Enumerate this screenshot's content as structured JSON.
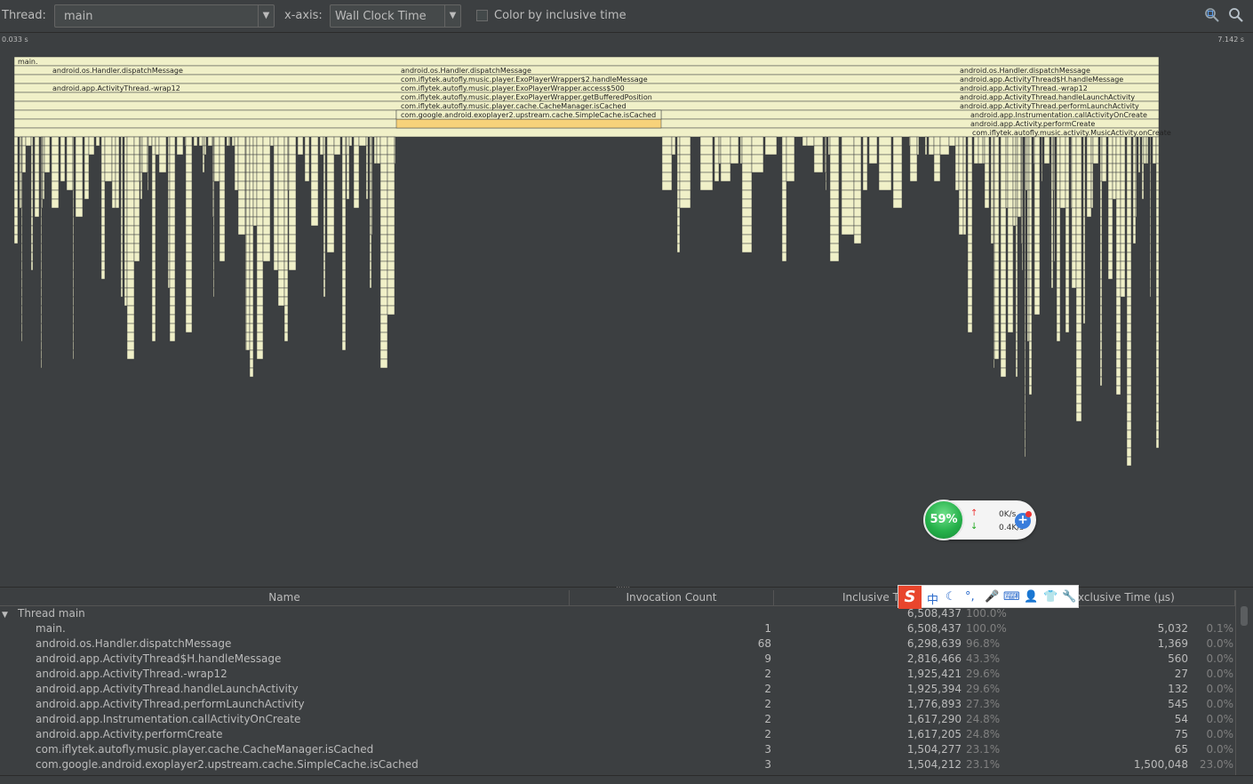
{
  "toolbar": {
    "thread_label": "Thread:",
    "thread_value": "main",
    "xaxis_label": "x-axis:",
    "xaxis_value": "Wall Clock Time",
    "color_checkbox_label": "Color by inclusive time",
    "color_checkbox_checked": false
  },
  "timebar": {
    "start": "0.033 s",
    "end": "7.142 s"
  },
  "flame_labels": [
    "main.",
    "android.os.Handler.dispatchMessage",
    "android.app.ActivityThread.-wrap12",
    "android.os.Handler.dispatchMessage",
    "com.iflytek.autofly.music.player.ExoPlayerWrapper$2.handleMessage",
    "com.iflytek.autofly.music.player.ExoPlayerWrapper.access$500",
    "com.iflytek.autofly.music.player.ExoPlayerWrapper.getBufferedPosition",
    "com.iflytek.autofly.music.player.cache.CacheManager.isCached",
    "com.google.android.exoplayer2.upstream.cache.SimpleCache.isCached",
    "android.os.Handler.dispatchMessage",
    "android.app.ActivityThread$H.handleMessage",
    "android.app.ActivityThread.-wrap12",
    "android.app.ActivityThread.handleLaunchActivity",
    "android.app.ActivityThread.performLaunchActivity",
    "android.app.Instrumentation.callActivityOnCreate",
    "android.app.Activity.performCreate",
    "com.iflytek.autofly.music.activity.MusicActivity.onCreate"
  ],
  "colors": {
    "flame_fill": "#f0f0c8",
    "flame_highlight": "#f7d27a",
    "background": "#3c3f41"
  },
  "speed_widget": {
    "percent": "59%",
    "upload": "0K/s",
    "download": "0.4K/s"
  },
  "table": {
    "headers": {
      "name": "Name",
      "invocation": "Invocation Count",
      "inclusive": "Inclusive Ti",
      "exclusive": "xclusive Time (µs)"
    },
    "group": {
      "label": "Thread main",
      "inclusive": "6,508,437",
      "inclusive_pct": "100.0%"
    },
    "rows": [
      {
        "name": "main.",
        "count": "1",
        "inc": "6,508,437",
        "inc_pct": "100.0%",
        "exc": "5,032",
        "exc_pct": "0.1%"
      },
      {
        "name": "android.os.Handler.dispatchMessage",
        "count": "68",
        "inc": "6,298,639",
        "inc_pct": "96.8%",
        "exc": "1,369",
        "exc_pct": "0.0%"
      },
      {
        "name": "android.app.ActivityThread$H.handleMessage",
        "count": "9",
        "inc": "2,816,466",
        "inc_pct": "43.3%",
        "exc": "560",
        "exc_pct": "0.0%"
      },
      {
        "name": "android.app.ActivityThread.-wrap12",
        "count": "2",
        "inc": "1,925,421",
        "inc_pct": "29.6%",
        "exc": "27",
        "exc_pct": "0.0%"
      },
      {
        "name": "android.app.ActivityThread.handleLaunchActivity",
        "count": "2",
        "inc": "1,925,394",
        "inc_pct": "29.6%",
        "exc": "132",
        "exc_pct": "0.0%"
      },
      {
        "name": "android.app.ActivityThread.performLaunchActivity",
        "count": "2",
        "inc": "1,776,893",
        "inc_pct": "27.3%",
        "exc": "545",
        "exc_pct": "0.0%"
      },
      {
        "name": "android.app.Instrumentation.callActivityOnCreate",
        "count": "2",
        "inc": "1,617,290",
        "inc_pct": "24.8%",
        "exc": "54",
        "exc_pct": "0.0%"
      },
      {
        "name": "android.app.Activity.performCreate",
        "count": "2",
        "inc": "1,617,205",
        "inc_pct": "24.8%",
        "exc": "75",
        "exc_pct": "0.0%"
      },
      {
        "name": "com.iflytek.autofly.music.player.cache.CacheManager.isCached",
        "count": "3",
        "inc": "1,504,277",
        "inc_pct": "23.1%",
        "exc": "65",
        "exc_pct": "0.0%"
      },
      {
        "name": "com.google.android.exoplayer2.upstream.cache.SimpleCache.isCached",
        "count": "3",
        "inc": "1,504,212",
        "inc_pct": "23.1%",
        "exc": "1,500,048",
        "exc_pct": "23.0%"
      }
    ]
  },
  "ime": {
    "logo": "S",
    "lang": "中"
  }
}
